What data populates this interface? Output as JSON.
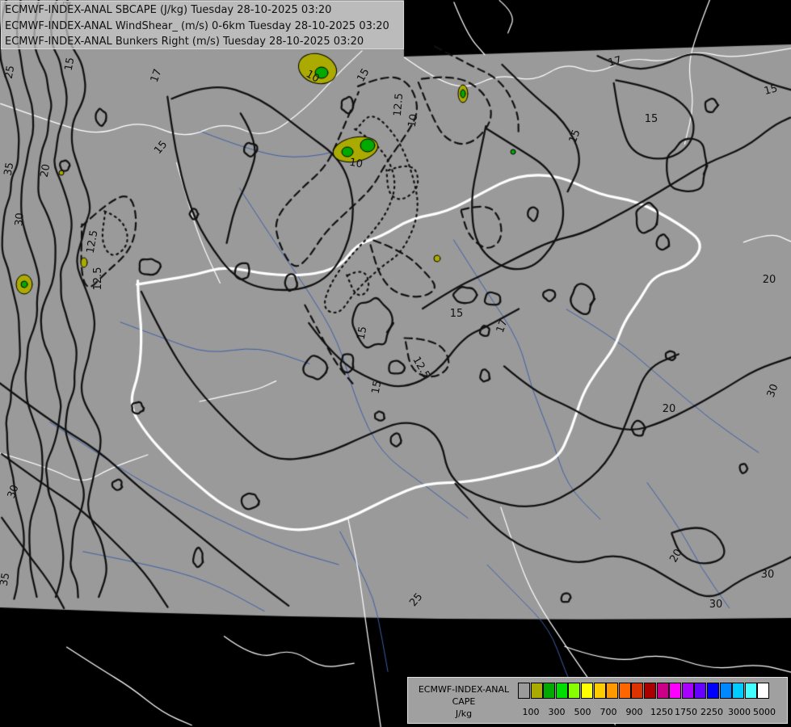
{
  "header": {
    "lines": [
      "ECMWF-INDEX-ANAL SBCAPE (J/kg) Tuesday 28-10-2025 03:20",
      "ECMWF-INDEX-ANAL WindShear_ (m/s) 0-6km Tuesday 28-10-2025 03:20",
      "ECMWF-INDEX-ANAL Bunkers Right (m/s) Tuesday 28-10-2025 03:20"
    ]
  },
  "legend": {
    "title_lines": [
      "ECMWF-INDEX-ANAL",
      "CAPE",
      "J/kg"
    ],
    "colors": [
      "#9a9a9a",
      "#aaaa00",
      "#00aa00",
      "#00dd00",
      "#88ff00",
      "#ffff00",
      "#ffcc00",
      "#ff9900",
      "#ff6600",
      "#dd3300",
      "#aa0000",
      "#cc0088",
      "#ff00ff",
      "#aa00ff",
      "#6600ff",
      "#0000ff",
      "#0088ff",
      "#00ccff",
      "#44ffff",
      "#ffffff"
    ],
    "tick_labels": [
      "100",
      "300",
      "500",
      "700",
      "900",
      "1250",
      "1750",
      "2250",
      "3000",
      "5000"
    ]
  },
  "map": {
    "colors": {
      "domain": "#9a9a9a",
      "outside": "#000000",
      "contour": "#111111",
      "border_major": "#ffffff",
      "river": "#3e5fa8"
    },
    "contour_labels": [
      "10",
      "12.5",
      "15",
      "17",
      "20",
      "25",
      "30",
      "35"
    ]
  }
}
